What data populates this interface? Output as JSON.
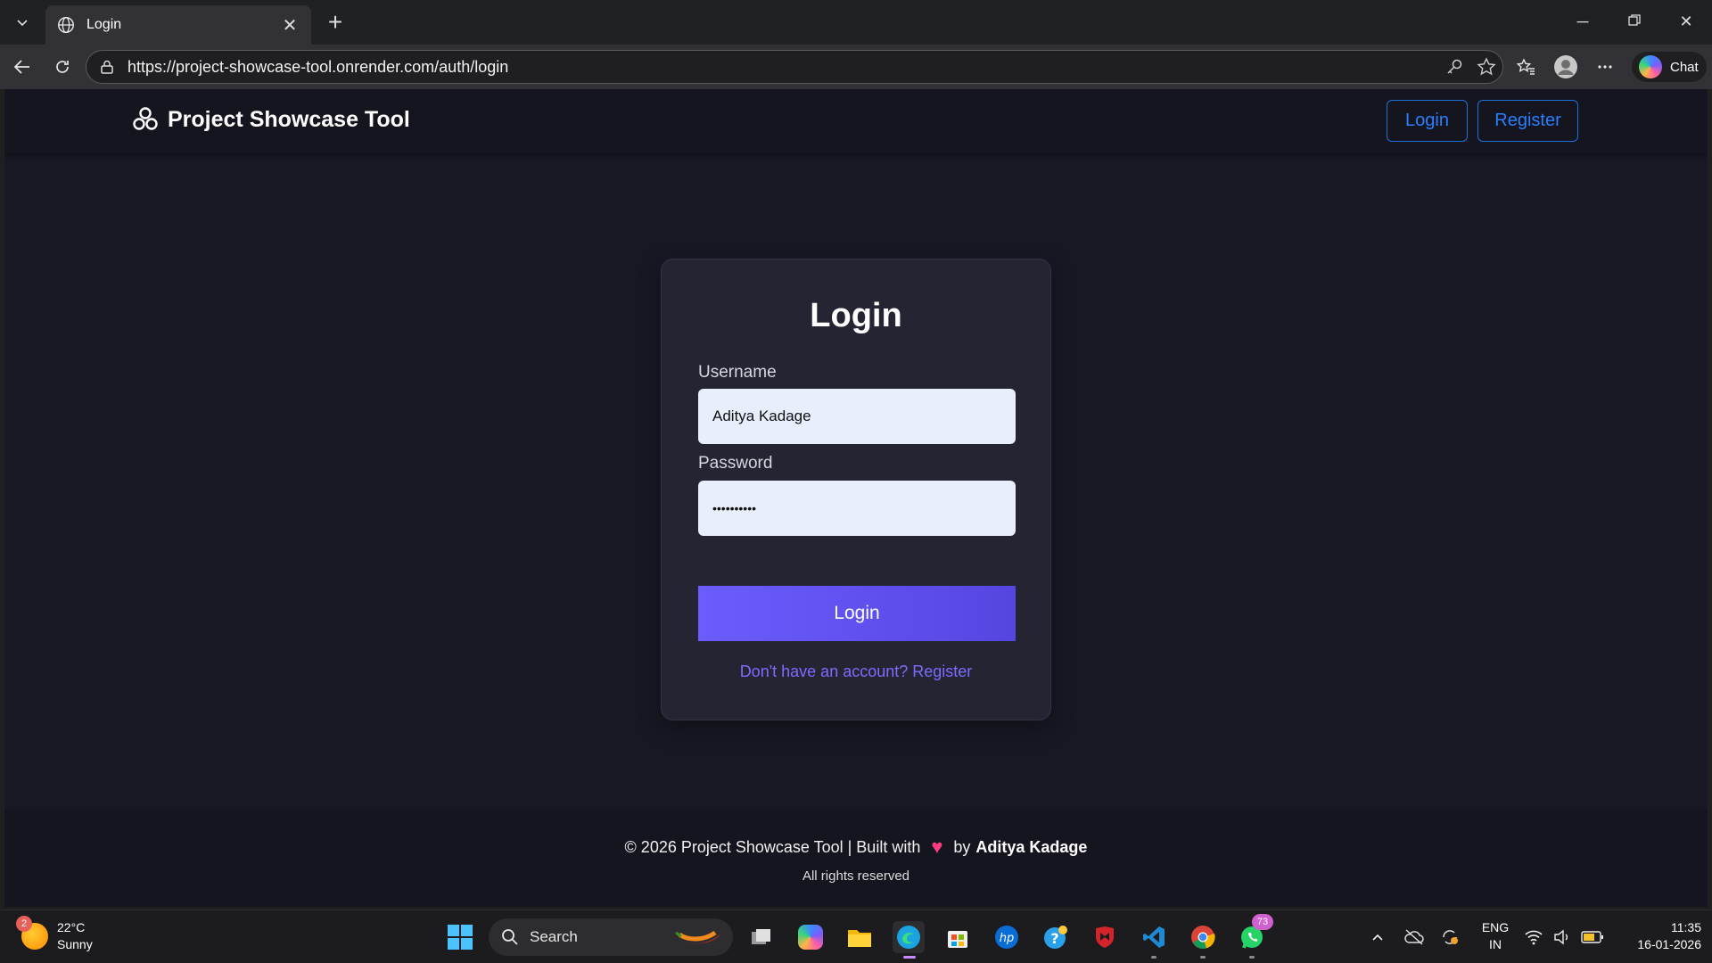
{
  "browser": {
    "tab_title": "Login",
    "url": "https://project-showcase-tool.onrender.com/auth/login",
    "chat_label": "Chat"
  },
  "site": {
    "brand": "Project Showcase Tool",
    "nav": {
      "login": "Login",
      "register": "Register"
    }
  },
  "login_form": {
    "title": "Login",
    "username_label": "Username",
    "username_value": "Aditya Kadage",
    "password_label": "Password",
    "password_value": "••••••••••",
    "submit_label": "Login",
    "register_link": "Don't have an account? Register"
  },
  "footer": {
    "line_prefix": "© 2026 Project Showcase Tool | Built with",
    "line_by": "by",
    "author": "Aditya Kadage",
    "rights": "All rights reserved"
  },
  "taskbar": {
    "weather_badge": "2",
    "temperature": "22°C",
    "condition": "Sunny",
    "search_label": "Search",
    "whatsapp_badge": "73",
    "language_line1": "ENG",
    "language_line2": "IN",
    "time": "11:35",
    "date": "16-01-2026"
  },
  "colors": {
    "page_background": "#181824",
    "card_background": "#242432",
    "accent_button": "#6b5cff",
    "link": "#7c6cff",
    "header_button": "#2a7fff",
    "heart": "#ff3d7f"
  }
}
